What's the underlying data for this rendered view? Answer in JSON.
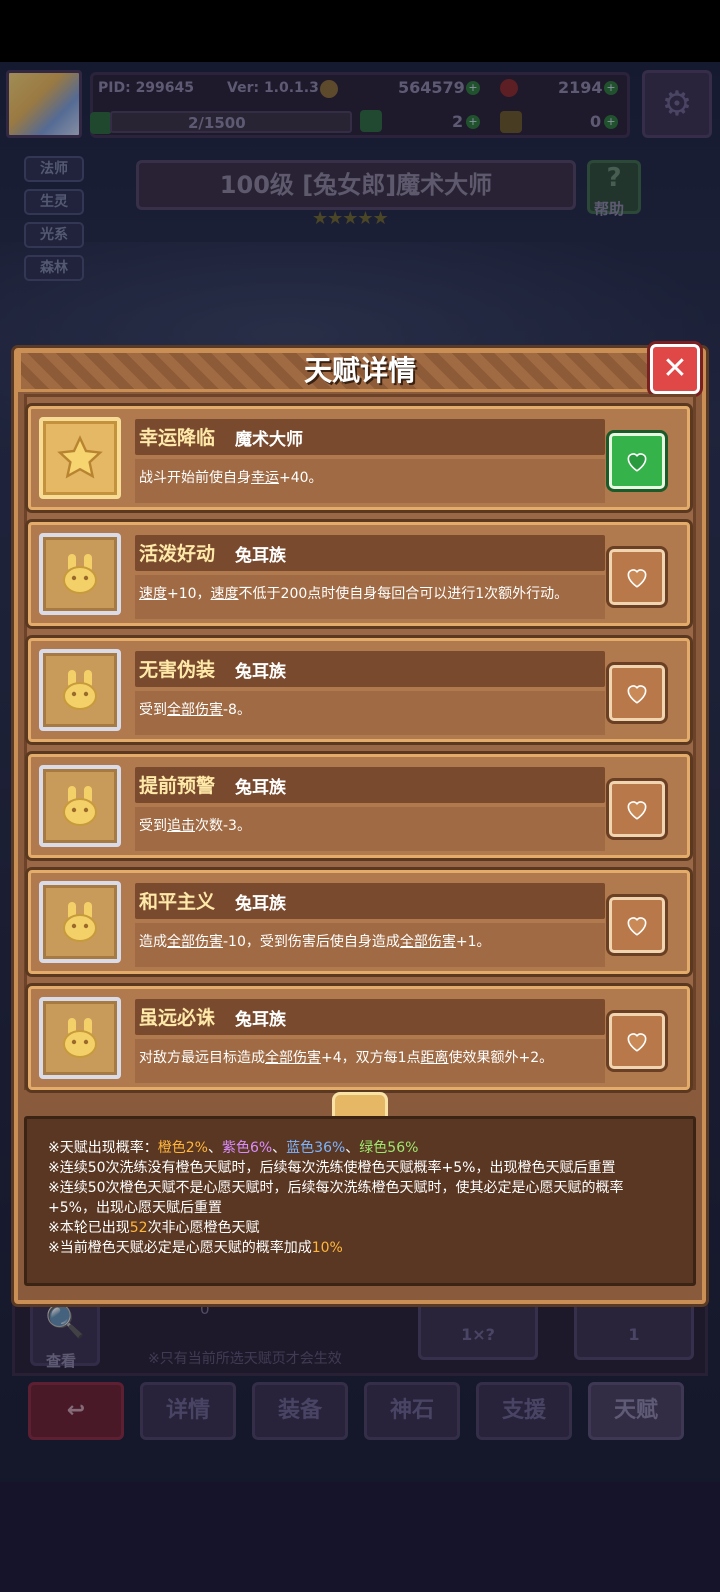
{
  "header": {
    "pid": "PID: 299645",
    "version": "Ver: 1.0.1.3",
    "gold": "564579",
    "gems": "2194",
    "exp": "2/1500",
    "clover_count": "2",
    "key_count": "0"
  },
  "class_tags": [
    "法师",
    "生灵",
    "光系",
    "森林"
  ],
  "hero": {
    "title": "100级  [兔女郎]魔术大师",
    "stars": "★★★★★",
    "help_label": "帮助"
  },
  "dialog": {
    "title": "天赋详情",
    "close_label": "✕",
    "talents": [
      {
        "name": "幸运降临",
        "source": "魔术大师",
        "desc_parts": [
          "战斗开始前使自身",
          "幸运",
          "+40。"
        ],
        "icon": "star-icon",
        "wish": true
      },
      {
        "name": "活泼好动",
        "source": "兔耳族",
        "desc_parts": [
          "速度",
          "+10，",
          "速度",
          "不低于200点时使自身每回合可以进行1次额外行动。"
        ],
        "icon": "rabbit-icon",
        "wish": false
      },
      {
        "name": "无害伪装",
        "source": "兔耳族",
        "desc_parts": [
          "受到",
          "全部伤害",
          "-8。"
        ],
        "icon": "rabbit-icon",
        "wish": false
      },
      {
        "name": "提前预警",
        "source": "兔耳族",
        "desc_parts": [
          "受到",
          "追击",
          "次数-3。"
        ],
        "icon": "rabbit-icon",
        "wish": false
      },
      {
        "name": "和平主义",
        "source": "兔耳族",
        "desc_parts": [
          "造成",
          "全部伤害",
          "-10，受到伤害后使自身造成",
          "全部伤害",
          "+1。"
        ],
        "icon": "rabbit-icon",
        "wish": false
      },
      {
        "name": "虽远必诛",
        "source": "兔耳族",
        "desc_parts": [
          "对敌方最远目标造成",
          "全部伤害",
          "+4，双方每1点",
          "距离",
          "使效果额外+2。"
        ],
        "icon": "rabbit-icon",
        "wish": false
      }
    ],
    "info": {
      "line1_prefix": "※天赋出现概率：",
      "orange": "橙色2%",
      "sep1": "、",
      "purple": "紫色6%",
      "sep2": "、",
      "blue": "蓝色36%",
      "sep3": "、",
      "green": "绿色56%",
      "line2": "※连续50次洗练没有橙色天赋时，后续每次洗练使橙色天赋概率+5%，出现橙色天赋后重置",
      "line3": "※连续50次橙色天赋不是心愿天赋时，后续每次洗练橙色天赋时，使其必定是心愿天赋的概率",
      "line4": "+5%，出现心愿天赋后重置",
      "line5_prefix": "※本轮已出现",
      "line5_num": "52",
      "line5_suffix": "次非心愿橙色天赋",
      "line6_prefix": "※当前橙色天赋必定是心愿天赋的概率加成",
      "line6_num": "10%"
    }
  },
  "underlay": {
    "search_label": "查看",
    "count": "0",
    "note": "※只有当前所选天赋页才会生效",
    "auto_value": "1×?",
    "reroll_value": "1"
  },
  "nav": {
    "back_icon": "return-icon",
    "tabs": [
      "详情",
      "装备",
      "神石",
      "支援",
      "天赋"
    ],
    "active": "天赋"
  },
  "colors": {
    "orange": "#ffb63b",
    "purple": "#d98cff",
    "blue": "#7db4ff",
    "green": "#9de86e",
    "wish_active": "#36b24a",
    "close": "#e04848"
  }
}
